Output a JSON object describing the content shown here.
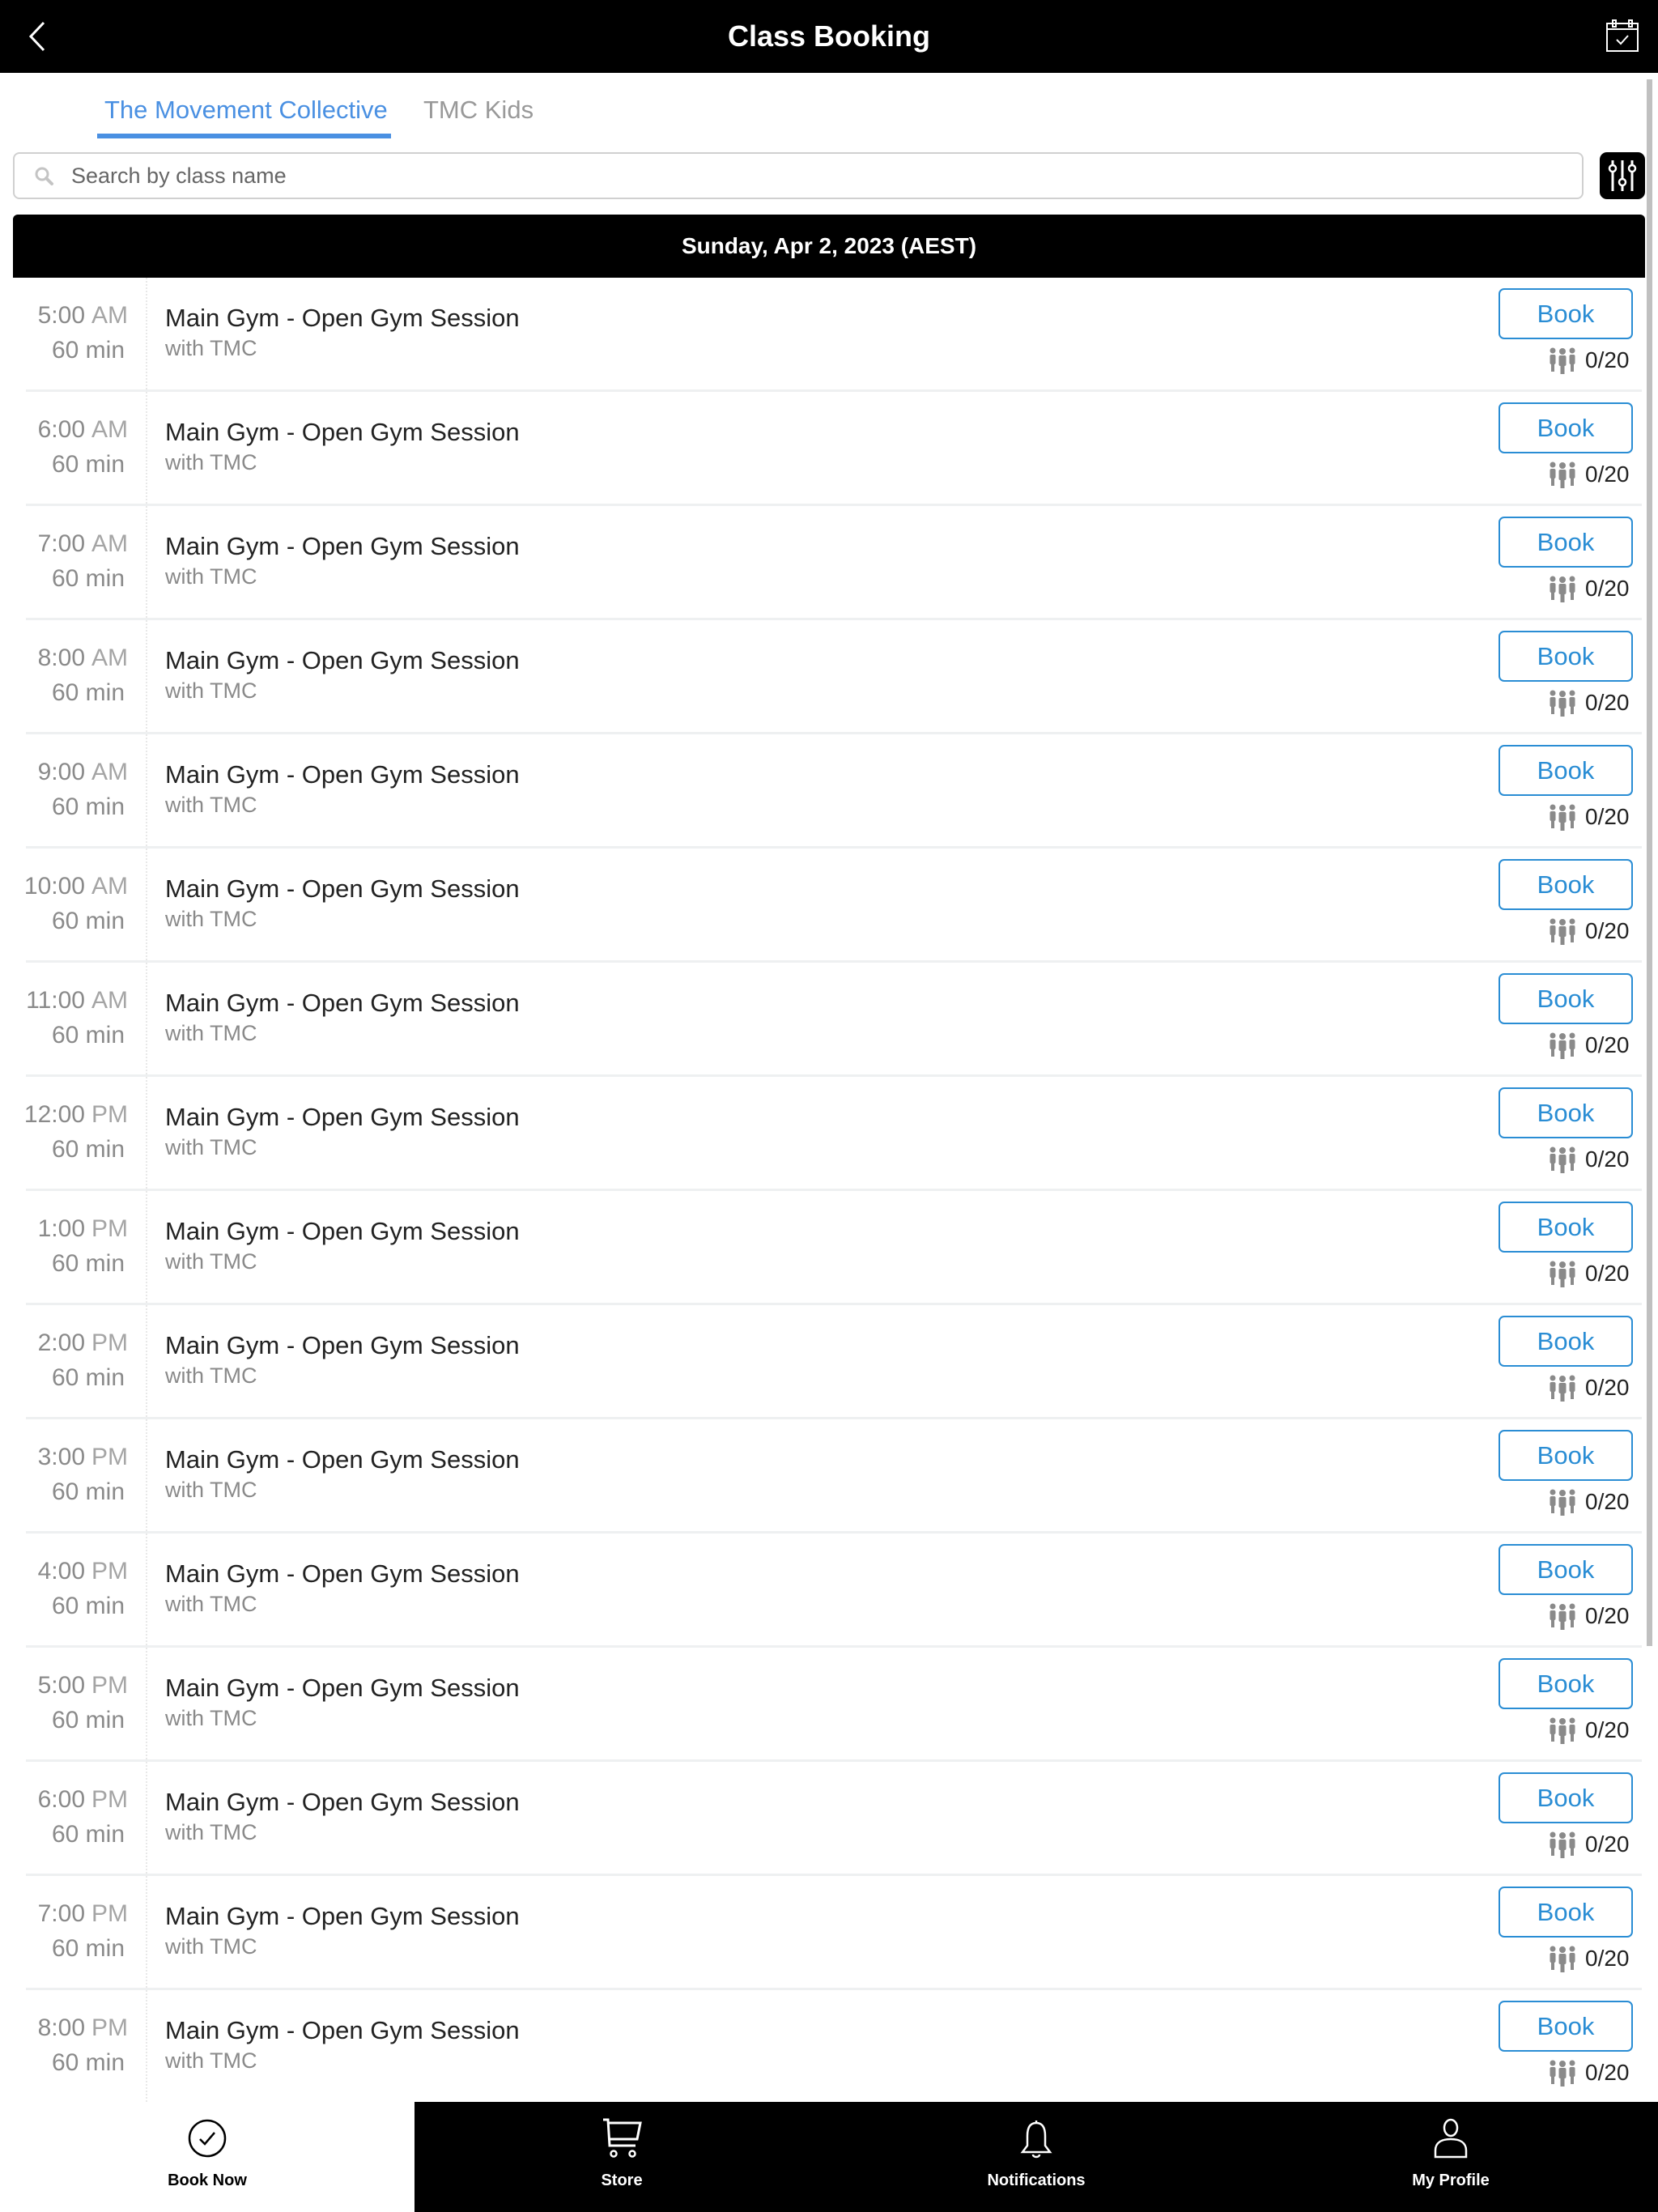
{
  "header": {
    "title": "Class Booking",
    "back_icon": "chevron-left-icon",
    "calendar_icon": "calendar-check-icon"
  },
  "tabs": [
    {
      "label": "The Movement Collective",
      "active": true
    },
    {
      "label": "TMC Kids",
      "active": false
    }
  ],
  "search": {
    "placeholder": "Search by class name",
    "value": ""
  },
  "filter_icon": "sliders-icon",
  "date_header": "Sunday, Apr 2, 2023 (AEST)",
  "colors": {
    "accent": "#4a90e2",
    "book_button": "#2a8dd4",
    "header_bg": "#000000"
  },
  "classes": [
    {
      "time": "5:00",
      "ampm": "AM",
      "duration": "60 min",
      "name": "Main Gym - Open Gym Session",
      "instructor": "with TMC",
      "button": "Book",
      "capacity": "0/20"
    },
    {
      "time": "6:00",
      "ampm": "AM",
      "duration": "60 min",
      "name": "Main Gym - Open Gym Session",
      "instructor": "with TMC",
      "button": "Book",
      "capacity": "0/20"
    },
    {
      "time": "7:00",
      "ampm": "AM",
      "duration": "60 min",
      "name": "Main Gym - Open Gym Session",
      "instructor": "with TMC",
      "button": "Book",
      "capacity": "0/20"
    },
    {
      "time": "8:00",
      "ampm": "AM",
      "duration": "60 min",
      "name": "Main Gym - Open Gym Session",
      "instructor": "with TMC",
      "button": "Book",
      "capacity": "0/20"
    },
    {
      "time": "9:00",
      "ampm": "AM",
      "duration": "60 min",
      "name": "Main Gym - Open Gym Session",
      "instructor": "with TMC",
      "button": "Book",
      "capacity": "0/20"
    },
    {
      "time": "10:00",
      "ampm": "AM",
      "duration": "60 min",
      "name": "Main Gym - Open Gym Session",
      "instructor": "with TMC",
      "button": "Book",
      "capacity": "0/20"
    },
    {
      "time": "11:00",
      "ampm": "AM",
      "duration": "60 min",
      "name": "Main Gym - Open Gym Session",
      "instructor": "with TMC",
      "button": "Book",
      "capacity": "0/20"
    },
    {
      "time": "12:00",
      "ampm": "PM",
      "duration": "60 min",
      "name": "Main Gym - Open Gym Session",
      "instructor": "with TMC",
      "button": "Book",
      "capacity": "0/20"
    },
    {
      "time": "1:00",
      "ampm": "PM",
      "duration": "60 min",
      "name": "Main Gym - Open Gym Session",
      "instructor": "with TMC",
      "button": "Book",
      "capacity": "0/20"
    },
    {
      "time": "2:00",
      "ampm": "PM",
      "duration": "60 min",
      "name": "Main Gym - Open Gym Session",
      "instructor": "with TMC",
      "button": "Book",
      "capacity": "0/20"
    },
    {
      "time": "3:00",
      "ampm": "PM",
      "duration": "60 min",
      "name": "Main Gym - Open Gym Session",
      "instructor": "with TMC",
      "button": "Book",
      "capacity": "0/20"
    },
    {
      "time": "4:00",
      "ampm": "PM",
      "duration": "60 min",
      "name": "Main Gym - Open Gym Session",
      "instructor": "with TMC",
      "button": "Book",
      "capacity": "0/20"
    },
    {
      "time": "5:00",
      "ampm": "PM",
      "duration": "60 min",
      "name": "Main Gym - Open Gym Session",
      "instructor": "with TMC",
      "button": "Book",
      "capacity": "0/20"
    },
    {
      "time": "6:00",
      "ampm": "PM",
      "duration": "60 min",
      "name": "Main Gym - Open Gym Session",
      "instructor": "with TMC",
      "button": "Book",
      "capacity": "0/20"
    },
    {
      "time": "7:00",
      "ampm": "PM",
      "duration": "60 min",
      "name": "Main Gym - Open Gym Session",
      "instructor": "with TMC",
      "button": "Book",
      "capacity": "0/20"
    },
    {
      "time": "8:00",
      "ampm": "PM",
      "duration": "60 min",
      "name": "Main Gym - Open Gym Session",
      "instructor": "with TMC",
      "button": "Book",
      "capacity": "0/20"
    }
  ],
  "bottom_nav": [
    {
      "label": "Book Now",
      "icon": "check-circle-icon",
      "active": true
    },
    {
      "label": "Store",
      "icon": "cart-icon",
      "active": false
    },
    {
      "label": "Notifications",
      "icon": "bell-icon",
      "active": false
    },
    {
      "label": "My Profile",
      "icon": "user-icon",
      "active": false
    }
  ]
}
